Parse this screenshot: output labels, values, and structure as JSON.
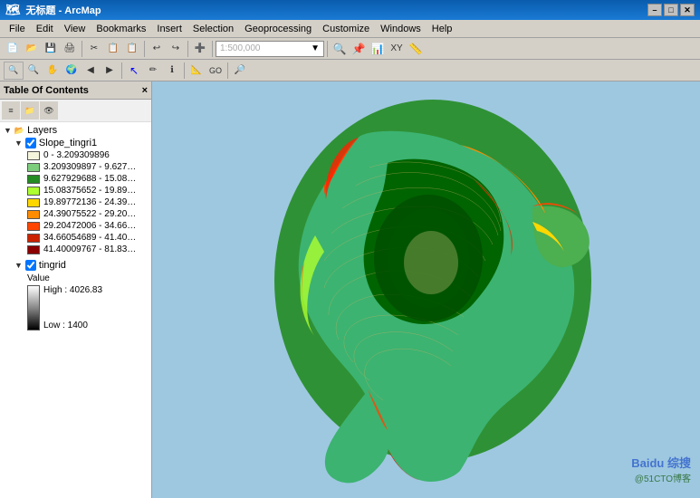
{
  "titlebar": {
    "title": "无标题 - ArcMap",
    "min_label": "–",
    "max_label": "□",
    "close_label": "✕"
  },
  "menubar": {
    "items": [
      "File",
      "Edit",
      "View",
      "Bookmarks",
      "Insert",
      "Selection",
      "Geoprocessing",
      "Customize",
      "Windows",
      "Help"
    ]
  },
  "toolbar1": {
    "icons": [
      "📄",
      "📂",
      "💾",
      "🖨",
      "✂",
      "📋",
      "📋",
      "↩",
      "↪",
      "➕",
      "🖰",
      "⟳"
    ],
    "dropdown_placeholder": ""
  },
  "toolbar2": {
    "icons": [
      "🔍",
      "🔍",
      "🔍",
      "🔍",
      "↔",
      "⬡",
      "✏",
      "ℹ",
      "📐",
      "🗺",
      "📏",
      "🔎"
    ]
  },
  "toc": {
    "title": "Table Of Contents",
    "close_label": "×",
    "layers_label": "Layers",
    "layer1": {
      "name": "Slope_tingri1",
      "checked": true,
      "legend": [
        {
          "color": "#f5f5dc",
          "label": "0 - 3.209309896"
        },
        {
          "color": "#7ccd7c",
          "label": "3.209309897 - 9.627…"
        },
        {
          "color": "#228b22",
          "label": "9.627929688 - 15.08…"
        },
        {
          "color": "#adff2f",
          "label": "15.08375652 - 19.89…"
        },
        {
          "color": "#ffd700",
          "label": "19.89772136 - 24.39…"
        },
        {
          "color": "#ff8c00",
          "label": "24.39075522 - 29.20…"
        },
        {
          "color": "#ff4500",
          "label": "29.20472006 - 34.66…"
        },
        {
          "color": "#cc2200",
          "label": "34.66054689 - 41.40…"
        },
        {
          "color": "#8b0000",
          "label": "41.40009767 - 81.83…"
        }
      ]
    },
    "layer2": {
      "name": "tingrid",
      "checked": true,
      "value_label": "Value",
      "high_label": "High : 4026.83",
      "low_label": "Low : 1400"
    }
  },
  "map": {
    "background_color": "#9ec8e0",
    "watermark1": "Baidu 综搜",
    "watermark2": "@51CTO博客"
  }
}
